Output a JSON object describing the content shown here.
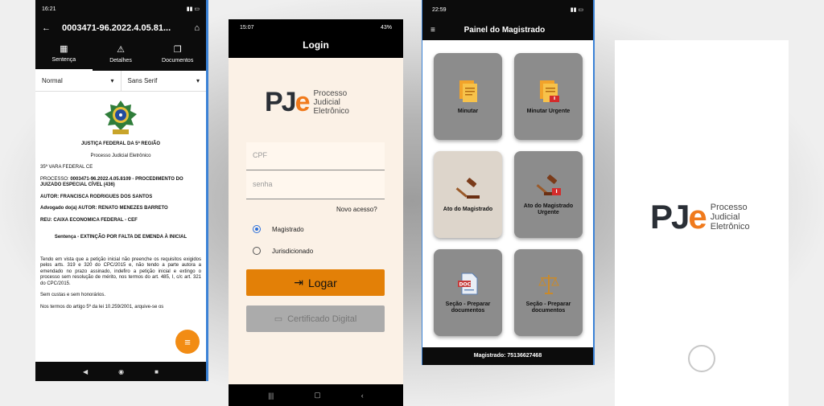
{
  "sentenca": {
    "status_time": "16:21",
    "status_right": "▮▮ ▭",
    "title": "0003471-96.2022.4.05.81...",
    "tabs": [
      {
        "label": "Sentença",
        "icon": "dashboard-icon"
      },
      {
        "label": "Detalhes",
        "icon": "warning-icon"
      },
      {
        "label": "Documentos",
        "icon": "documents-icon"
      }
    ],
    "format_select": "Normal",
    "font_select": "Sans Serif",
    "doc": {
      "court": "JUSTIÇA FEDERAL DA 5ª REGIÃO",
      "system": "Processo Judicial Eletrônico",
      "vara": "35ª VARA FEDERAL CE",
      "processo_label": "PROCESSO: ",
      "processo": "0003471-96.2022.4.05.8109 - PROCEDIMENTO DO JUIZADO ESPECIAL CÍVEL (436)",
      "autor": "AUTOR: FRANCISCA RODRIGUES DOS SANTOS",
      "advogado_label": "Advogado do(a) AUTOR: ",
      "advogado": "RENATO MENEZES BARRETO",
      "reu": "REU: CAIXA ECONOMICA FEDERAL - CEF",
      "sentence_title": "Sentença - EXTINÇÃO POR FALTA DE EMENDA À INICIAL",
      "paragraph1": "Tendo em vista que a petição inicial não preenche os requisitos exigidos pelos arts. 319 e 320 do CPC/2015 e, não tendo a parte autora a emendado no prazo assinado, indefiro a petição inicial e extingo o processo sem resolução de mérito, nos termos do art. 485, I, c/c art. 321 do CPC/2015.",
      "paragraph2": "Sem custas e sem honorários.",
      "paragraph3": "Nos termos do artigo 5º da lei 10.259/2001, arquive-se os"
    }
  },
  "login": {
    "status_time": "15:07",
    "status_right": "43%",
    "title": "Login",
    "logo_pj": "PJ",
    "logo_e": "e",
    "logo_line1": "Processo",
    "logo_line2": "Judicial",
    "logo_line3": "Eletrônico",
    "cpf_placeholder": "CPF",
    "senha_placeholder": "senha",
    "novo_acesso": "Novo acesso?",
    "radio_magistrado": "Magistrado",
    "radio_jurisdicionado": "Jurisdicionado",
    "logar": "Logar",
    "certificado": "Certificado Digital"
  },
  "painel": {
    "status_time": "22:59",
    "title": "Painel do Magistrado",
    "cards": [
      {
        "label": "Minutar",
        "icon": "document-icon",
        "highlighted": false
      },
      {
        "label": "Minutar Urgente",
        "icon": "urgent-document-icon",
        "highlighted": false
      },
      {
        "label": "Ato do Magistrado",
        "icon": "gavel-icon",
        "highlighted": true
      },
      {
        "label": "Ato do Magistrado Urgente",
        "icon": "urgent-gavel-icon",
        "highlighted": false
      },
      {
        "label": "Seção - Preparar documentos",
        "icon": "doc-file-icon",
        "highlighted": false
      },
      {
        "label": "Seção - Preparar documentos",
        "icon": "scales-icon",
        "highlighted": false
      }
    ],
    "footer": "Magistrado: 75136627468"
  },
  "splash": {
    "logo_pj": "PJ",
    "logo_e": "e",
    "logo_line1": "Processo",
    "logo_line2": "Judicial",
    "logo_line3": "Eletrônico"
  },
  "colors": {
    "brand_orange": "#f07a1c",
    "button_orange": "#e38007",
    "brand_dark": "#2a2f36",
    "selected_blue": "#2a6fdb"
  }
}
